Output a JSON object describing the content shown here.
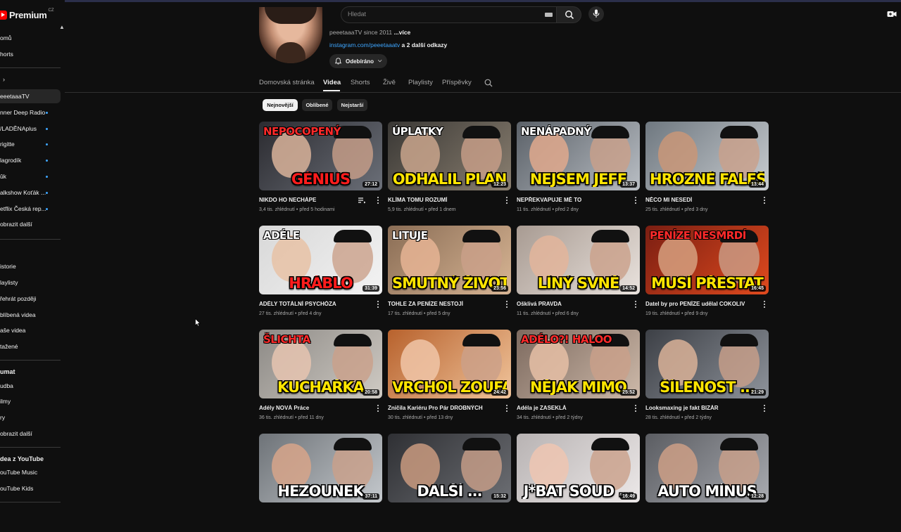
{
  "app": {
    "logo_text": "Premium",
    "logo_region": "CZ"
  },
  "search": {
    "placeholder": "Hledat"
  },
  "sidebar": {
    "items": [
      {
        "label": "omů",
        "active": false,
        "dot": false
      },
      {
        "label": "horts",
        "active": false,
        "dot": false
      },
      {
        "label": "eeetaaaTV",
        "active": true,
        "dot": false
      },
      {
        "label": "nner Deep Radio",
        "active": false,
        "dot": true
      },
      {
        "label": "/LADĚNAplus",
        "active": false,
        "dot": true
      },
      {
        "label": "rigitte",
        "active": false,
        "dot": true
      },
      {
        "label": "lagrodík",
        "active": false,
        "dot": true
      },
      {
        "label": "ûk",
        "active": false,
        "dot": true
      },
      {
        "label": "alkshow Koťák ...",
        "active": false,
        "dot": true
      },
      {
        "label": "etflix Česká rep...",
        "active": false,
        "dot": true
      },
      {
        "label": "obrazit další",
        "active": false,
        "dot": false
      },
      {
        "label": "istorie",
        "active": false,
        "dot": false
      },
      {
        "label": "laylisty",
        "active": false,
        "dot": false
      },
      {
        "label": "řehrát později",
        "active": false,
        "dot": false
      },
      {
        "label": "blíbená videa",
        "active": false,
        "dot": false
      },
      {
        "label": "aše videa",
        "active": false,
        "dot": false
      },
      {
        "label": "tažené",
        "active": false,
        "dot": false
      },
      {
        "label": "udba",
        "active": false,
        "dot": false
      },
      {
        "label": "ilmy",
        "active": false,
        "dot": false
      },
      {
        "label": "ry",
        "active": false,
        "dot": false
      },
      {
        "label": "obrazit další",
        "active": false,
        "dot": false
      },
      {
        "label": "ouTube Music",
        "active": false,
        "dot": false
      },
      {
        "label": "ouTube Kids",
        "active": false,
        "dot": false
      }
    ],
    "headings": {
      "explore": "umat",
      "more_from_youtube": "dea z YouTube"
    }
  },
  "channel": {
    "since": "peeetaaaTV since 2011",
    "more_label": "...více",
    "link_url": "instagram.com/peeetaaatv",
    "link_extra": " a 2 další odkazy",
    "subscribe_label": "Odebíráno"
  },
  "tabs": [
    "Domovská stránka",
    "Videa",
    "Shorts",
    "Živě",
    "Playlisty",
    "Příspěvky"
  ],
  "active_tab": "Videa",
  "chips": [
    {
      "label": "Nejnovější",
      "active": true
    },
    {
      "label": "Oblíbené",
      "active": false
    },
    {
      "label": "Nejstarší",
      "active": false
    }
  ],
  "videos": [
    {
      "title": "NIKDO HO NECHÁPE",
      "meta": "3,4 tis. zhlédnutí • před 5 hodinami",
      "duration": "27:12",
      "top_text": "NEPOCOPENÝ",
      "overlay": "GÉNIUS",
      "overlay_color": "red",
      "bg": [
        "#2b2b30",
        "#6b6f78"
      ],
      "skin": "#d9b39a"
    },
    {
      "title": "KLÍMA TOMU ROZUMÍ",
      "meta": "5,9 tis. zhlédnutí • před 1 dnem",
      "duration": "12:23",
      "top_text": "ÚPLATKY",
      "overlay": "ODHALIL PLÁN",
      "overlay_color": "yellow",
      "bg": [
        "#3a3835",
        "#8a7f70"
      ],
      "skin": "#c9a58c"
    },
    {
      "title": "NEPŘEKVAPUJE MĚ TO",
      "meta": "11 tis. zhlédnutí • před 2 dny",
      "duration": "13:37",
      "top_text": "NENÁPADNÝ",
      "overlay": "NEJSEM JEFF",
      "overlay_color": "yellow",
      "bg": [
        "#5b6168",
        "#b9bec4"
      ],
      "skin": "#e0a98d"
    },
    {
      "title": "NĚCO MI NESEDÍ",
      "meta": "25 tis. zhlédnutí • před 3 dny",
      "duration": "13:44",
      "top_text": "",
      "overlay": "HROZNÉ FALEŠNÉ",
      "overlay_color": "yellow",
      "bg": [
        "#6f7880",
        "#c8ccd0"
      ],
      "skin": "#c99778"
    },
    {
      "title": "ADÉLY TOTÁLNÍ PSYCHÓZA",
      "meta": "27 tis. zhlédnutí • před 4 dny",
      "duration": "31:39",
      "top_text": "ADÉLE",
      "overlay": "HRÁBLO",
      "overlay_color": "red",
      "bg": [
        "#d8d8d8",
        "#f3f3f3"
      ],
      "skin": "#e8c2a6"
    },
    {
      "title": "TOHLE ZA PENÍZE NESTOJÍ",
      "meta": "17 tis. zhlédnutí • před 5 dny",
      "duration": "23:56",
      "top_text": "LITUJE",
      "overlay": "SMUTNÝ ŽIVOT",
      "overlay_color": "yellow",
      "bg": [
        "#8a6d55",
        "#d8b594"
      ],
      "skin": "#e6b494"
    },
    {
      "title": "Ošklivá PRAVDA",
      "meta": "11 tis. zhlédnutí • před 6 dny",
      "duration": "14:52",
      "top_text": "",
      "overlay": "LÍNÝ SVNĚ",
      "overlay_color": "yellow",
      "bg": [
        "#a89b92",
        "#e9e2dd"
      ],
      "skin": "#e3b59b"
    },
    {
      "title": "Datel by pro PENÍZE udělal COKOLIV",
      "meta": "19 tis. zhlédnutí • před 9 dny",
      "duration": "16:45",
      "top_text": "PENÍZE NESMRDÍ",
      "overlay": "MUSÍ PŘESTAT",
      "overlay_color": "yellow",
      "bg": [
        "#7a1e12",
        "#e04a1e"
      ],
      "skin": "#d6a07f"
    },
    {
      "title": "Adély NOVÁ Práce",
      "meta": "36 tis. zhlédnutí • před 11 dny",
      "duration": "20:58",
      "top_text": "ŠLICHTA",
      "overlay": "KUCHAŘKA",
      "overlay_color": "yellow",
      "bg": [
        "#8d8a86",
        "#cfcac3"
      ],
      "skin": "#e6c4b0"
    },
    {
      "title": "Zničila Kariéru Pro Pár DROBNÝCH",
      "meta": "30 tis. zhlédnutí • před 13 dny",
      "duration": "24:42",
      "top_text": "",
      "overlay": "VRCHOL ZOUFALSTVÍ",
      "overlay_color": "yellow",
      "bg": [
        "#b8622d",
        "#f0c49b"
      ],
      "skin": "#f0c6a8"
    },
    {
      "title": "Adéla je ZASEKLÁ",
      "meta": "34 tis. zhlédnutí • před 2 týdny",
      "duration": "25:52",
      "top_text": "ADÉLO?! HALOO",
      "overlay": "NĚJAK MIMO",
      "overlay_color": "yellow",
      "bg": [
        "#7d6a5f",
        "#cdb9a9"
      ],
      "skin": "#e6bfa6"
    },
    {
      "title": "Looksmaxing je fakt BIZÁR",
      "meta": "28 tis. zhlédnutí • před 2 týdny",
      "duration": "21:29",
      "top_text": "",
      "overlay": "ŠÍLENOST ...",
      "overlay_color": "yellow",
      "bg": [
        "#3d4046",
        "#8e939b"
      ],
      "skin": "#d9b198"
    },
    {
      "title": "",
      "meta": "",
      "duration": "37:11",
      "top_text": "",
      "overlay": "HEZOUNEK",
      "overlay_color": "white",
      "bg": [
        "#6e7378",
        "#c4c8cc"
      ],
      "skin": "#d7a48a"
    },
    {
      "title": "",
      "meta": "",
      "duration": "15:32",
      "top_text": "",
      "overlay": "DALŠÍ ...",
      "overlay_color": "white",
      "bg": [
        "#2f3034",
        "#6c6e73"
      ],
      "skin": "#c99a7f"
    },
    {
      "title": "",
      "meta": "",
      "duration": "16:49",
      "top_text": "",
      "overlay": "J*BAT SOUD ...",
      "overlay_color": "white",
      "bg": [
        "#b8b3b3",
        "#ece8e8"
      ],
      "skin": "#efc6b2"
    },
    {
      "title": "",
      "meta": "",
      "duration": "12:28",
      "top_text": "",
      "overlay": "AUTO MÍNUS",
      "overlay_color": "white",
      "bg": [
        "#5b5d62",
        "#a8aab0"
      ],
      "skin": "#cc9f86"
    }
  ]
}
